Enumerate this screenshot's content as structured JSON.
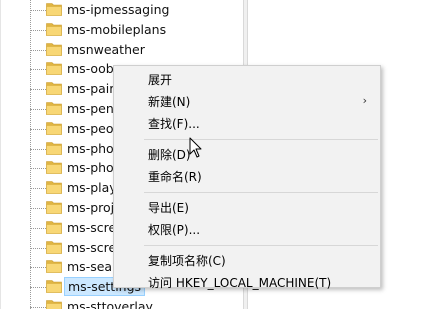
{
  "tree": {
    "items": [
      {
        "label": "ms-ipmessaging"
      },
      {
        "label": "ms-mobileplans"
      },
      {
        "label": "msnweather"
      },
      {
        "label": "ms-oob"
      },
      {
        "label": "ms-pair"
      },
      {
        "label": "ms-pen"
      },
      {
        "label": "ms-peo"
      },
      {
        "label": "ms-pho"
      },
      {
        "label": "ms-pho"
      },
      {
        "label": "ms-play"
      },
      {
        "label": "ms-proj"
      },
      {
        "label": "ms-scre"
      },
      {
        "label": "ms-scre"
      },
      {
        "label": "ms-sear"
      },
      {
        "label": "ms-settings",
        "selected": true
      },
      {
        "label": "ms-sttoverlay"
      }
    ],
    "folder_color": "#f8d775",
    "folder_dark": "#e0b543",
    "selection_color": "#cce8ff"
  },
  "context_menu": {
    "items": [
      {
        "label": "展开"
      },
      {
        "label": "新建(N)",
        "submenu_arrow": "›"
      },
      {
        "label": "查找(F)..."
      },
      {
        "separator": true
      },
      {
        "label": "删除(D)"
      },
      {
        "label": "重命名(R)"
      },
      {
        "separator": true
      },
      {
        "label": "导出(E)"
      },
      {
        "label": "权限(P)..."
      },
      {
        "separator": true
      },
      {
        "label": "复制项名称(C)"
      },
      {
        "label": "访问 HKEY_LOCAL_MACHINE(T)"
      }
    ]
  }
}
